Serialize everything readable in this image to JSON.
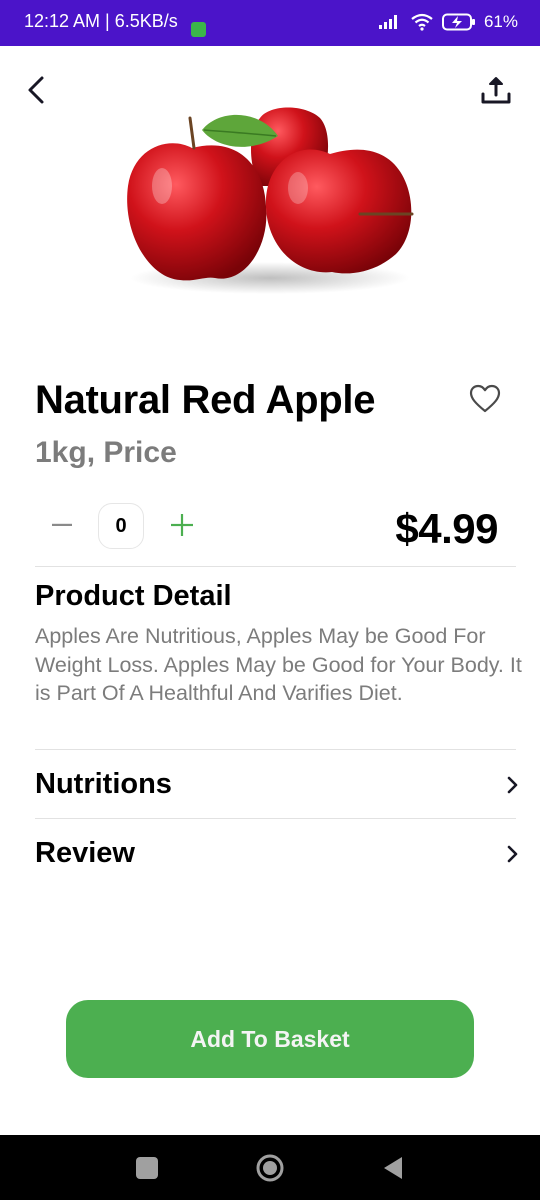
{
  "status_bar": {
    "time": "12:12 AM | 6.5KB/s",
    "battery": "61%",
    "icons": [
      "signal-icon",
      "wifi-icon",
      "battery-charging-icon"
    ]
  },
  "toolbar": {
    "back_icon": "chevron-left-icon",
    "share_icon": "upload-share-icon"
  },
  "product": {
    "name": "Natural Red Apple",
    "unit": "1kg, Price",
    "quantity": "0",
    "price": "$4.99",
    "favorite_icon": "heart-outline-icon"
  },
  "detail": {
    "title": "Product Detail",
    "text": "Apples Are Nutritious, Apples May be Good For Weight Loss. Apples May be Good for Your Body. It is Part Of A Healthful And Varifies Diet."
  },
  "sections": [
    {
      "label": "Nutritions"
    },
    {
      "label": "Review"
    }
  ],
  "cta": {
    "label": "Add To Basket"
  },
  "colors": {
    "status_bar": "#4b14c9",
    "accent": "#4caf50",
    "muted_text": "#7c7c7c",
    "apple_red": "#c8151b"
  }
}
